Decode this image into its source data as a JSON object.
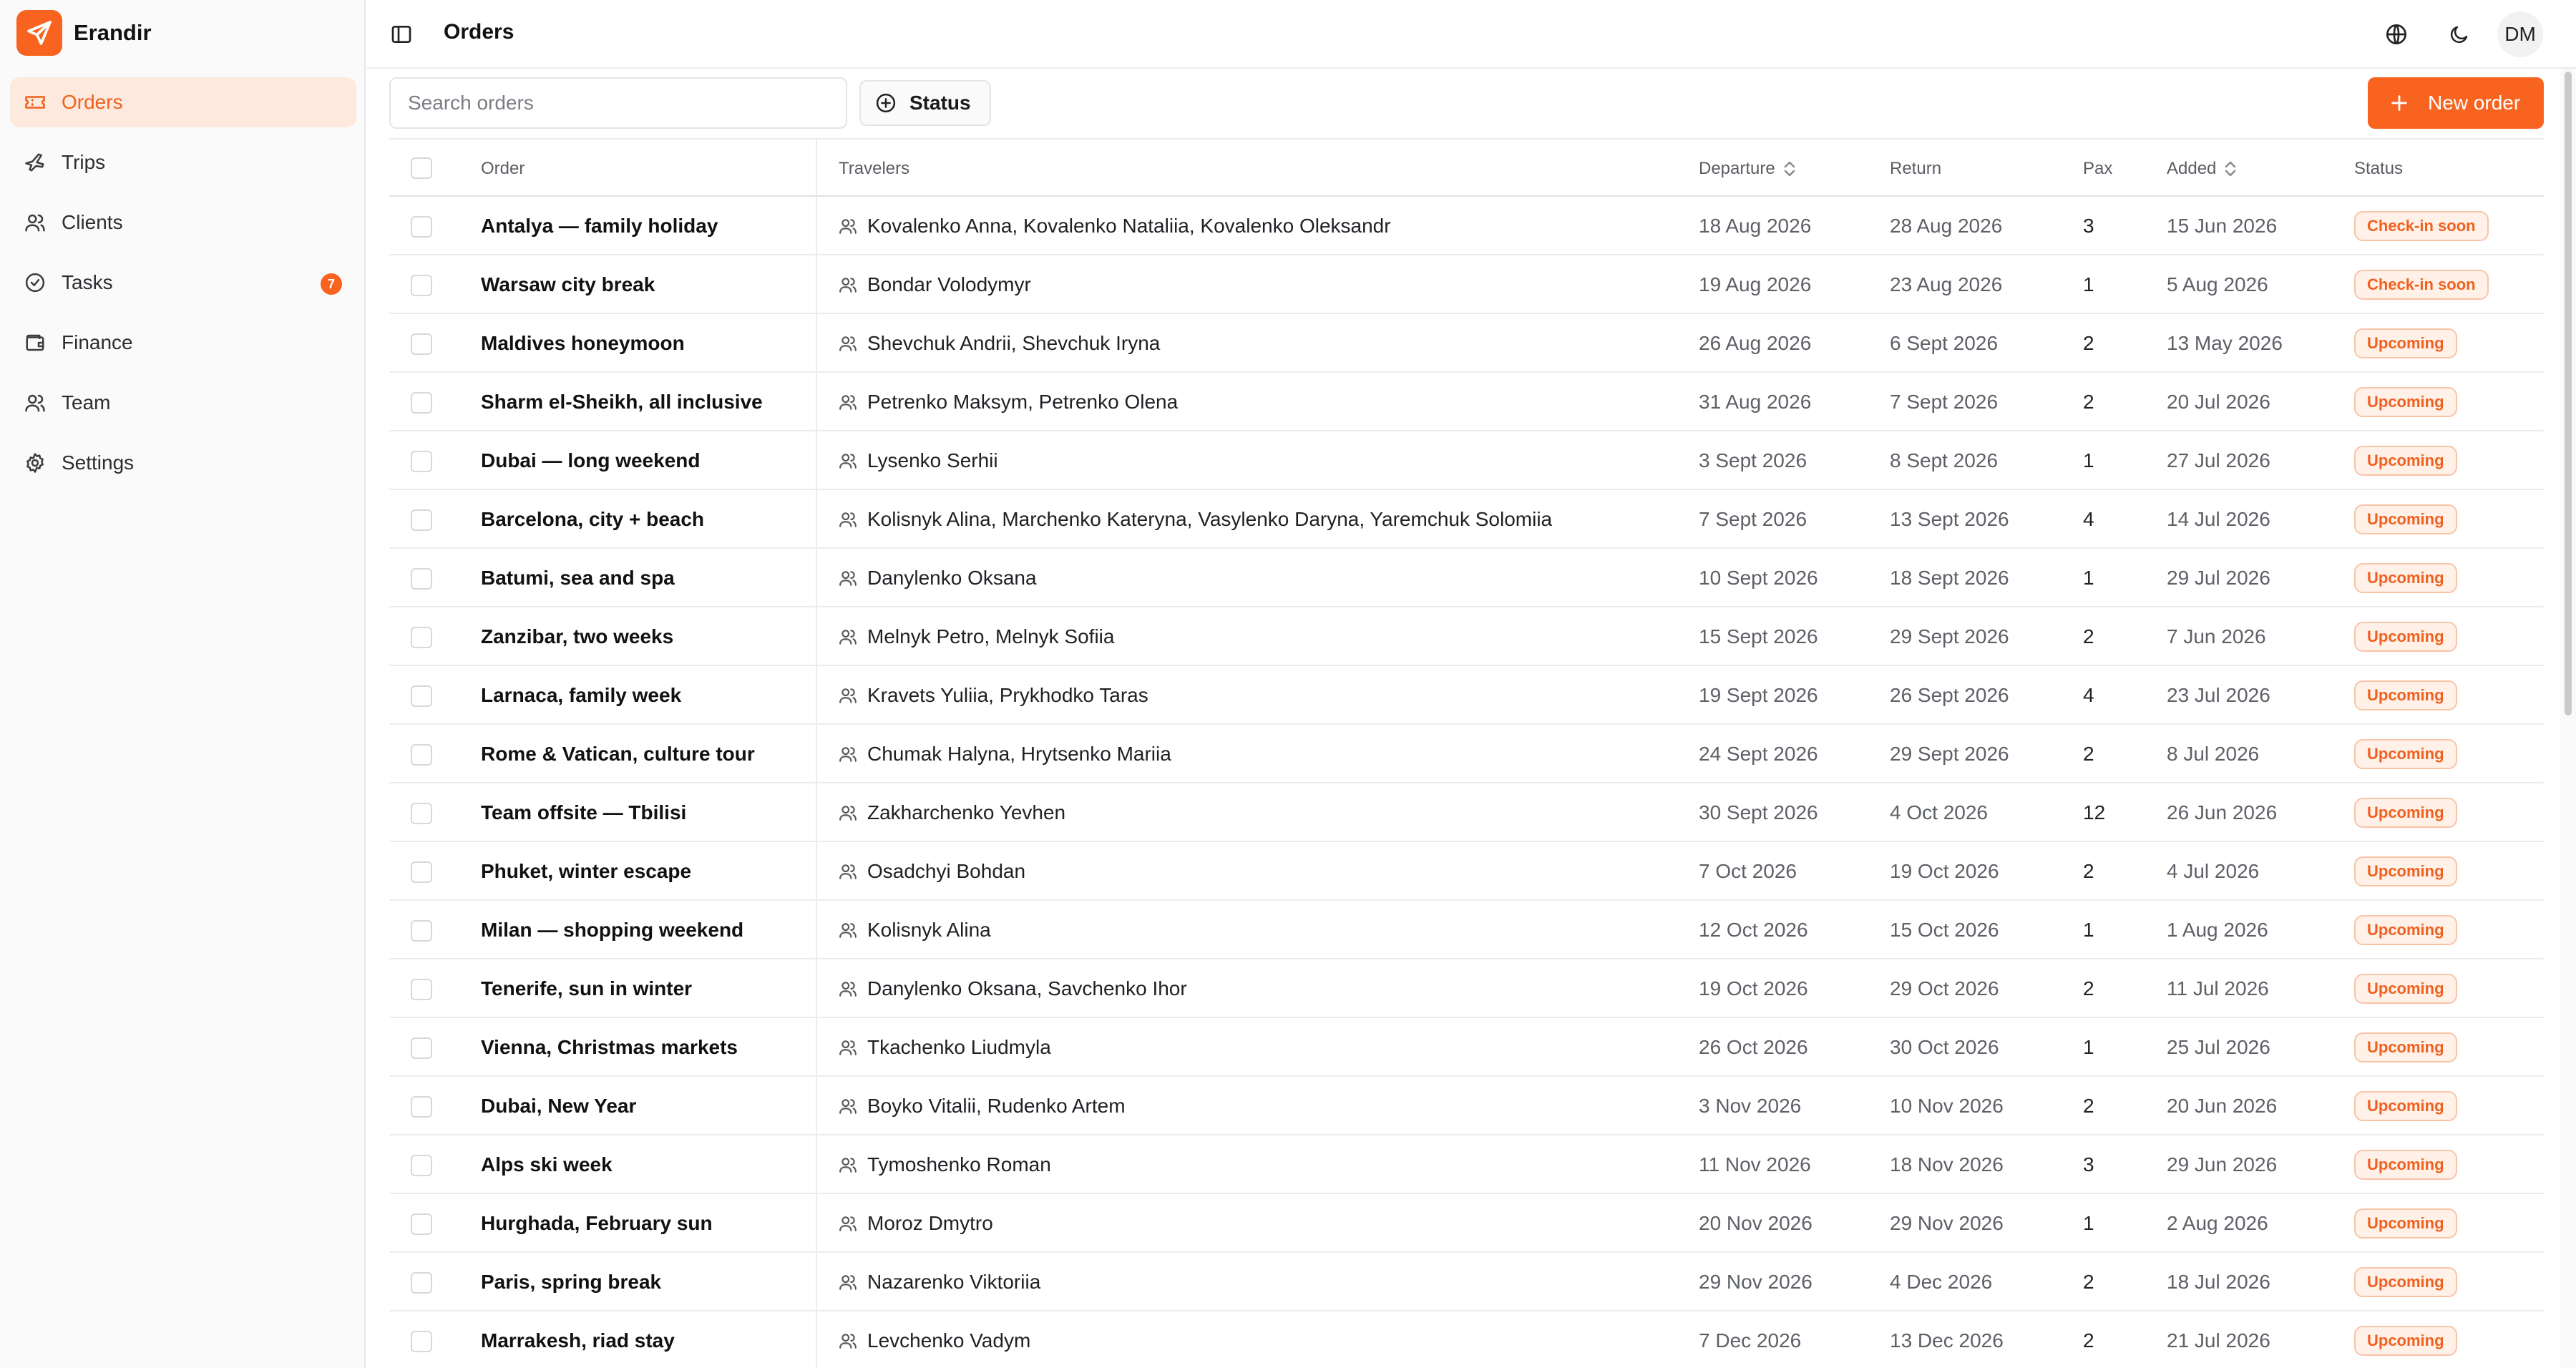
{
  "brand": {
    "name": "Erandir",
    "accent": "#f86420"
  },
  "sidebar": {
    "items": [
      {
        "label": "Orders",
        "icon": "ticket-icon",
        "active": true
      },
      {
        "label": "Trips",
        "icon": "plane-icon"
      },
      {
        "label": "Clients",
        "icon": "users-icon"
      },
      {
        "label": "Tasks",
        "icon": "check-circle-icon",
        "badge": "7"
      },
      {
        "label": "Finance",
        "icon": "wallet-icon"
      },
      {
        "label": "Team",
        "icon": "users-icon"
      },
      {
        "label": "Settings",
        "icon": "gear-icon"
      }
    ]
  },
  "header": {
    "title": "Orders",
    "avatar_initials": "DM"
  },
  "toolbar": {
    "search_placeholder": "Search orders",
    "status_filter_label": "Status",
    "new_order_label": "New order"
  },
  "table": {
    "columns": {
      "order": "Order",
      "travelers": "Travelers",
      "departure": "Departure",
      "return": "Return",
      "pax": "Pax",
      "added": "Added",
      "status": "Status"
    },
    "rows": [
      {
        "order": "Antalya — family holiday",
        "travelers": "Kovalenko Anna, Kovalenko Nataliia, Kovalenko Oleksandr",
        "departure": "18 Aug 2026",
        "return": "28 Aug 2026",
        "pax": "3",
        "added": "15 Jun 2026",
        "status": "Check-in soon"
      },
      {
        "order": "Warsaw city break",
        "travelers": "Bondar Volodymyr",
        "departure": "19 Aug 2026",
        "return": "23 Aug 2026",
        "pax": "1",
        "added": "5 Aug 2026",
        "status": "Check-in soon"
      },
      {
        "order": "Maldives honeymoon",
        "travelers": "Shevchuk Andrii, Shevchuk Iryna",
        "departure": "26 Aug 2026",
        "return": "6 Sept 2026",
        "pax": "2",
        "added": "13 May 2026",
        "status": "Upcoming"
      },
      {
        "order": "Sharm el-Sheikh, all inclusive",
        "travelers": "Petrenko Maksym, Petrenko Olena",
        "departure": "31 Aug 2026",
        "return": "7 Sept 2026",
        "pax": "2",
        "added": "20 Jul 2026",
        "status": "Upcoming"
      },
      {
        "order": "Dubai — long weekend",
        "travelers": "Lysenko Serhii",
        "departure": "3 Sept 2026",
        "return": "8 Sept 2026",
        "pax": "1",
        "added": "27 Jul 2026",
        "status": "Upcoming"
      },
      {
        "order": "Barcelona, city + beach",
        "travelers": "Kolisnyk Alina, Marchenko Kateryna, Vasylenko Daryna, Yaremchuk Solomiia",
        "departure": "7 Sept 2026",
        "return": "13 Sept 2026",
        "pax": "4",
        "added": "14 Jul 2026",
        "status": "Upcoming"
      },
      {
        "order": "Batumi, sea and spa",
        "travelers": "Danylenko Oksana",
        "departure": "10 Sept 2026",
        "return": "18 Sept 2026",
        "pax": "1",
        "added": "29 Jul 2026",
        "status": "Upcoming"
      },
      {
        "order": "Zanzibar, two weeks",
        "travelers": "Melnyk Petro, Melnyk Sofiia",
        "departure": "15 Sept 2026",
        "return": "29 Sept 2026",
        "pax": "2",
        "added": "7 Jun 2026",
        "status": "Upcoming"
      },
      {
        "order": "Larnaca, family week",
        "travelers": "Kravets Yuliia, Prykhodko Taras",
        "departure": "19 Sept 2026",
        "return": "26 Sept 2026",
        "pax": "4",
        "added": "23 Jul 2026",
        "status": "Upcoming"
      },
      {
        "order": "Rome & Vatican, culture tour",
        "travelers": "Chumak Halyna, Hrytsenko Mariia",
        "departure": "24 Sept 2026",
        "return": "29 Sept 2026",
        "pax": "2",
        "added": "8 Jul 2026",
        "status": "Upcoming"
      },
      {
        "order": "Team offsite — Tbilisi",
        "travelers": "Zakharchenko Yevhen",
        "departure": "30 Sept 2026",
        "return": "4 Oct 2026",
        "pax": "12",
        "added": "26 Jun 2026",
        "status": "Upcoming"
      },
      {
        "order": "Phuket, winter escape",
        "travelers": "Osadchyi Bohdan",
        "departure": "7 Oct 2026",
        "return": "19 Oct 2026",
        "pax": "2",
        "added": "4 Jul 2026",
        "status": "Upcoming"
      },
      {
        "order": "Milan — shopping weekend",
        "travelers": "Kolisnyk Alina",
        "departure": "12 Oct 2026",
        "return": "15 Oct 2026",
        "pax": "1",
        "added": "1 Aug 2026",
        "status": "Upcoming"
      },
      {
        "order": "Tenerife, sun in winter",
        "travelers": "Danylenko Oksana, Savchenko Ihor",
        "departure": "19 Oct 2026",
        "return": "29 Oct 2026",
        "pax": "2",
        "added": "11 Jul 2026",
        "status": "Upcoming"
      },
      {
        "order": "Vienna, Christmas markets",
        "travelers": "Tkachenko Liudmyla",
        "departure": "26 Oct 2026",
        "return": "30 Oct 2026",
        "pax": "1",
        "added": "25 Jul 2026",
        "status": "Upcoming"
      },
      {
        "order": "Dubai, New Year",
        "travelers": "Boyko Vitalii, Rudenko Artem",
        "departure": "3 Nov 2026",
        "return": "10 Nov 2026",
        "pax": "2",
        "added": "20 Jun 2026",
        "status": "Upcoming"
      },
      {
        "order": "Alps ski week",
        "travelers": "Tymoshenko Roman",
        "departure": "11 Nov 2026",
        "return": "18 Nov 2026",
        "pax": "3",
        "added": "29 Jun 2026",
        "status": "Upcoming"
      },
      {
        "order": "Hurghada, February sun",
        "travelers": "Moroz Dmytro",
        "departure": "20 Nov 2026",
        "return": "29 Nov 2026",
        "pax": "1",
        "added": "2 Aug 2026",
        "status": "Upcoming"
      },
      {
        "order": "Paris, spring break",
        "travelers": "Nazarenko Viktoriia",
        "departure": "29 Nov 2026",
        "return": "4 Dec 2026",
        "pax": "2",
        "added": "18 Jul 2026",
        "status": "Upcoming"
      },
      {
        "order": "Marrakesh, riad stay",
        "travelers": "Levchenko Vadym",
        "departure": "7 Dec 2026",
        "return": "13 Dec 2026",
        "pax": "2",
        "added": "21 Jul 2026",
        "status": "Upcoming"
      }
    ]
  }
}
